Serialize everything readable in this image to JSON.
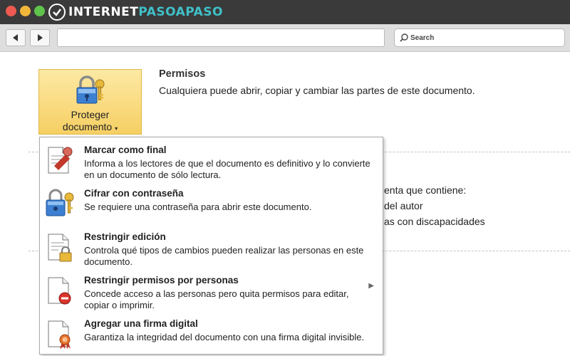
{
  "browser": {
    "brand_main": "INTERNET",
    "brand_accent": "PASOAPASO",
    "search_placeholder": "Search"
  },
  "protect": {
    "label_line1": "Proteger",
    "label_line2": "documento",
    "caret": "▾"
  },
  "permissions": {
    "title": "Permisos",
    "description": "Cualquiera puede abrir, copiar y cambiar las partes de este documento."
  },
  "background_text": [
    "enta que contiene:",
    "del autor",
    "as con discapacidades"
  ],
  "menu": {
    "items": [
      {
        "title": "Marcar como final",
        "description": "Informa a los lectores de que el documento es definitivo y lo convierte en un documento de sólo lectura.",
        "icon": "mark-final-icon"
      },
      {
        "title": "Cifrar con contraseña",
        "description": "Se requiere una contraseña para abrir este documento.",
        "icon": "lock-key-icon"
      },
      {
        "title": "Restringir edición",
        "description": "Controla qué tipos de cambios pueden realizar las personas en este documento.",
        "icon": "document-lock-icon"
      },
      {
        "title": "Restringir permisos por personas",
        "description": "Concede acceso a las personas pero quita permisos para editar, copiar o imprimir.",
        "icon": "document-restrict-icon",
        "has_submenu": true
      },
      {
        "title": "Agregar una firma digital",
        "description": "Garantiza la integridad del documento con una firma digital invisible.",
        "icon": "document-ribbon-icon"
      }
    ]
  },
  "colors": {
    "protect_button": "#f6cf63",
    "accent_teal": "#3fc0c8",
    "titlebar": "#3a3a3a"
  }
}
